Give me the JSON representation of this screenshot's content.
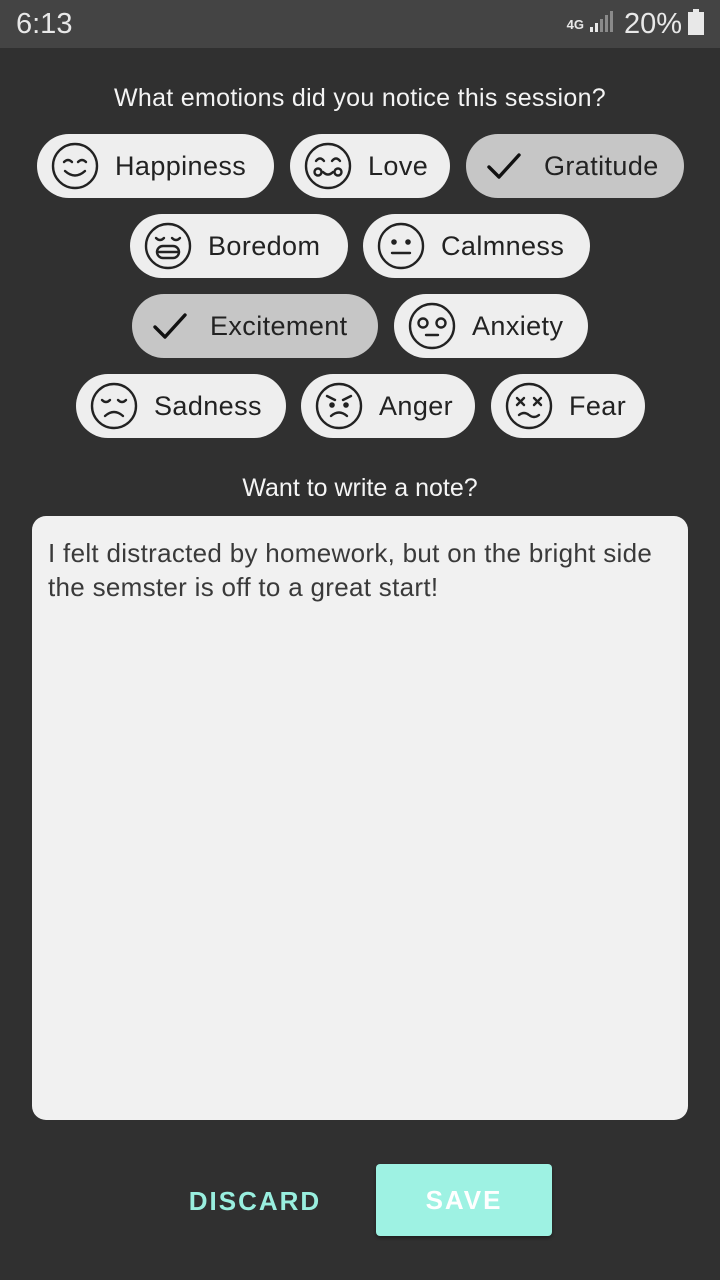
{
  "status_bar": {
    "time": "6:13",
    "network": "4G",
    "battery_percent": "20%"
  },
  "emotions_prompt": "What emotions did you notice this session?",
  "emotions": [
    {
      "label": "Happiness",
      "icon": "smiling-face-icon",
      "selected": false
    },
    {
      "label": "Love",
      "icon": "love-face-icon",
      "selected": false
    },
    {
      "label": "Gratitude",
      "icon": "checkmark-icon",
      "selected": true
    },
    {
      "label": "Boredom",
      "icon": "bored-face-icon",
      "selected": false
    },
    {
      "label": "Calmness",
      "icon": "neutral-face-icon",
      "selected": false
    },
    {
      "label": "Excitement",
      "icon": "checkmark-icon",
      "selected": true
    },
    {
      "label": "Anxiety",
      "icon": "anxious-face-icon",
      "selected": false
    },
    {
      "label": "Sadness",
      "icon": "sad-face-icon",
      "selected": false
    },
    {
      "label": "Anger",
      "icon": "angry-face-icon",
      "selected": false
    },
    {
      "label": "Fear",
      "icon": "fearful-face-icon",
      "selected": false
    }
  ],
  "note_prompt": "Want to write a note?",
  "note_text": "I felt distracted by homework, but on the bright side the semster is off to a great start!",
  "actions": {
    "discard_label": "DISCARD",
    "save_label": "SAVE"
  },
  "colors": {
    "background": "#303030",
    "chip": "#eeeeee",
    "chip_selected": "#c6c6c6",
    "accent": "#9ef2e3"
  }
}
